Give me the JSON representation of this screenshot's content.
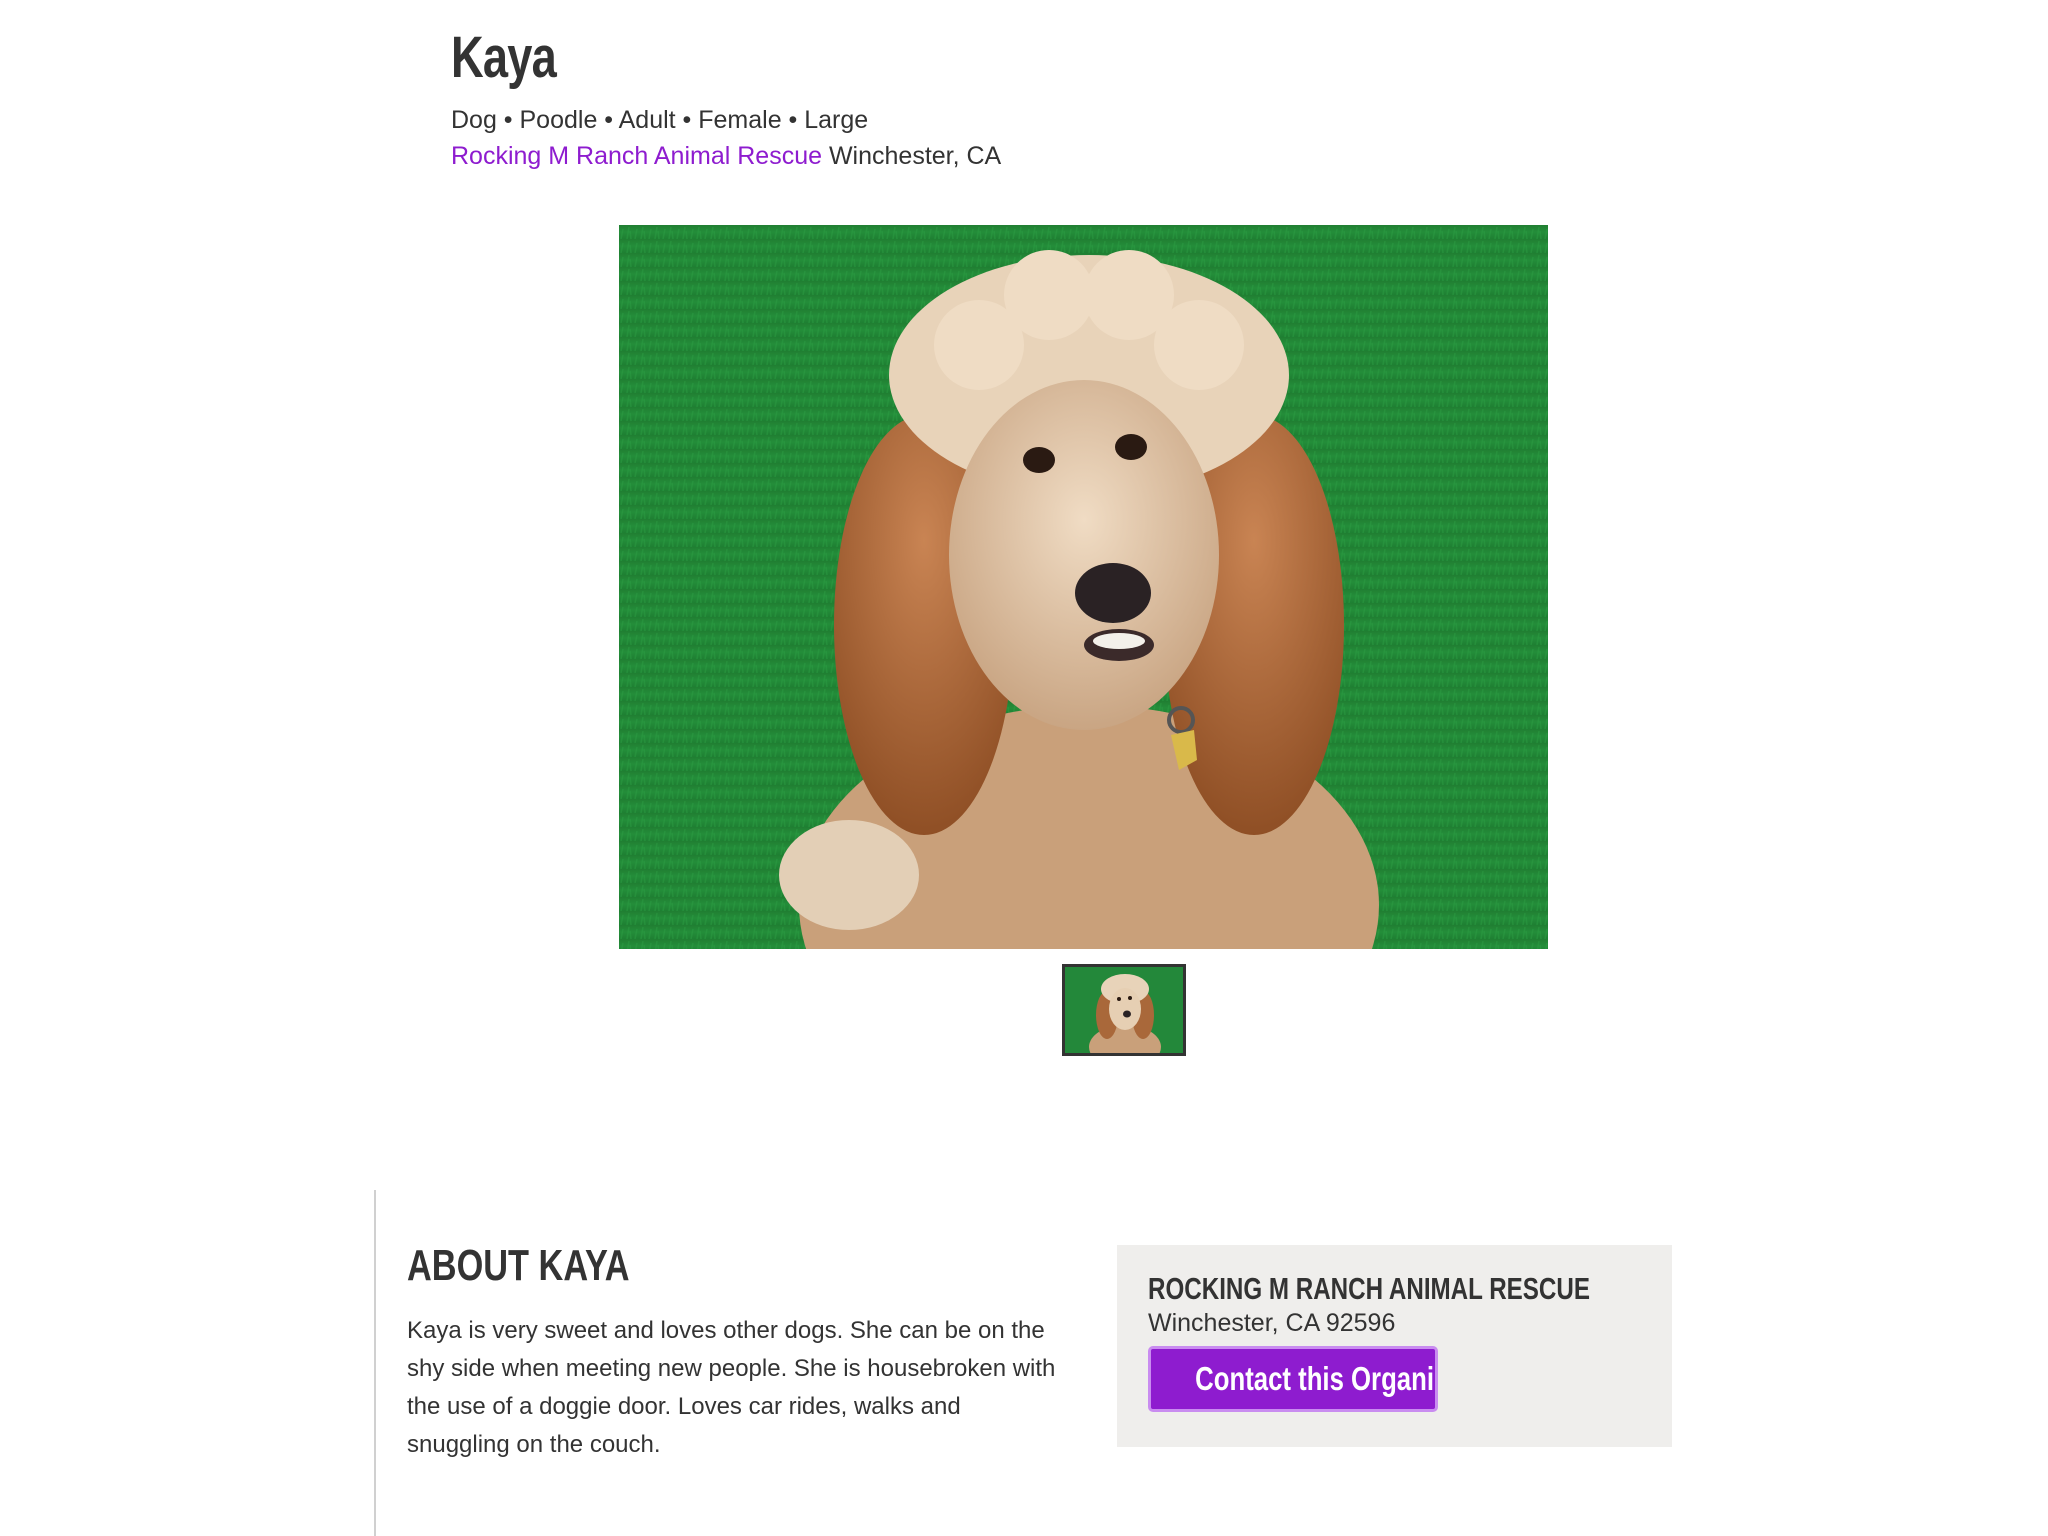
{
  "pet": {
    "name": "Kaya",
    "meta": "Dog • Poodle • Adult • Female • Large",
    "organization_link": "Rocking M Ranch Animal Rescue",
    "location": "Winchester, CA"
  },
  "photo": {
    "main_icon": "poodle-photo",
    "thumbnail_icon": "poodle-thumbnail"
  },
  "about": {
    "title": "ABOUT KAYA",
    "text": "Kaya is very sweet and loves other dogs. She can be on the shy side when meeting new people. She is housebroken with the use of a doggie door. Loves car rides, walks and snuggling on the couch."
  },
  "organization": {
    "name": "ROCKING M RANCH ANIMAL RESCUE",
    "address": "Winchester, CA 92596",
    "contact_label": "Contact this Organization"
  },
  "colors": {
    "accent": "#8e1ccf",
    "card_bg": "#efeeec",
    "text": "#333333"
  }
}
